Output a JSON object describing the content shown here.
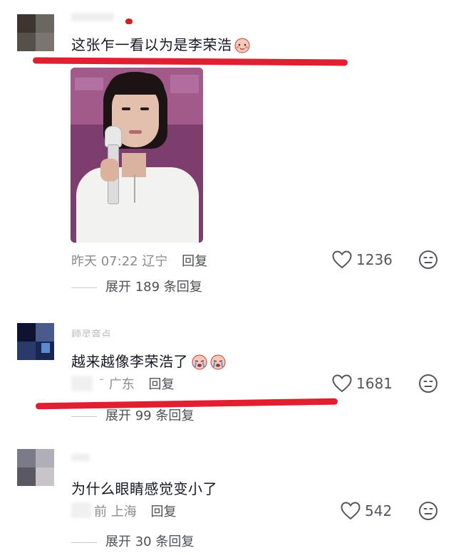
{
  "comments": [
    {
      "text": "这张乍一看以为是李荣浩",
      "emoji": "blushing-pink-face-emoji",
      "time": "昨天 07:22",
      "location": "辽宁",
      "reply_label": "回复",
      "likes": "1236",
      "expand_label": "展开 189 条回复"
    },
    {
      "username": "顾灵音点",
      "text": "越来越像李荣浩了",
      "emoji": "crying-pink-face-emoji",
      "time": "",
      "location": "广东",
      "reply_label": "回复",
      "likes": "1681",
      "expand_label": "展开 99 条回复"
    },
    {
      "text": "为什么眼睛感觉变小了",
      "time": "前",
      "location": "上海",
      "reply_label": "回复",
      "likes": "542",
      "expand_label": "展开 30 条回复"
    }
  ],
  "colors": {
    "annotation_red": "#e02030",
    "text_primary": "#161823",
    "text_secondary": "#8a8b91"
  }
}
